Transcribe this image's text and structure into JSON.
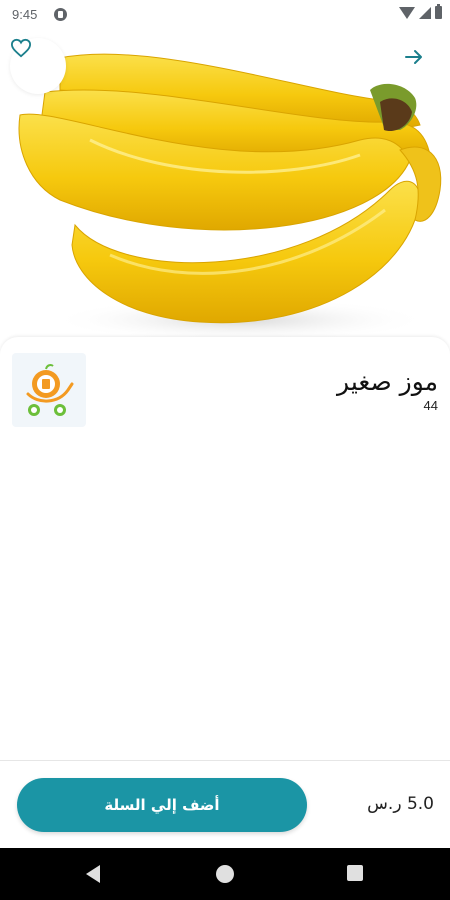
{
  "status_bar": {
    "time": "9:45",
    "icons": [
      "app-notification-icon",
      "wifi-icon",
      "signal-icon",
      "battery-icon"
    ]
  },
  "hero": {
    "image": "bananas-photo",
    "favorite_icon": "heart-icon",
    "forward_icon": "arrow-right-icon"
  },
  "product": {
    "name": "موز صغير",
    "code": "44",
    "store_logo": "store-cart-logo"
  },
  "cart_bar": {
    "add_label": "أضف إلي السلة",
    "price": "5.0 ر.س"
  },
  "colors": {
    "accent": "#1b95a5",
    "banana": "#f6c90e",
    "logo_orange": "#f39a21",
    "logo_green": "#6cbf3a"
  },
  "nav_bar": {
    "icons": [
      "back-icon",
      "home-icon",
      "recents-icon"
    ]
  }
}
